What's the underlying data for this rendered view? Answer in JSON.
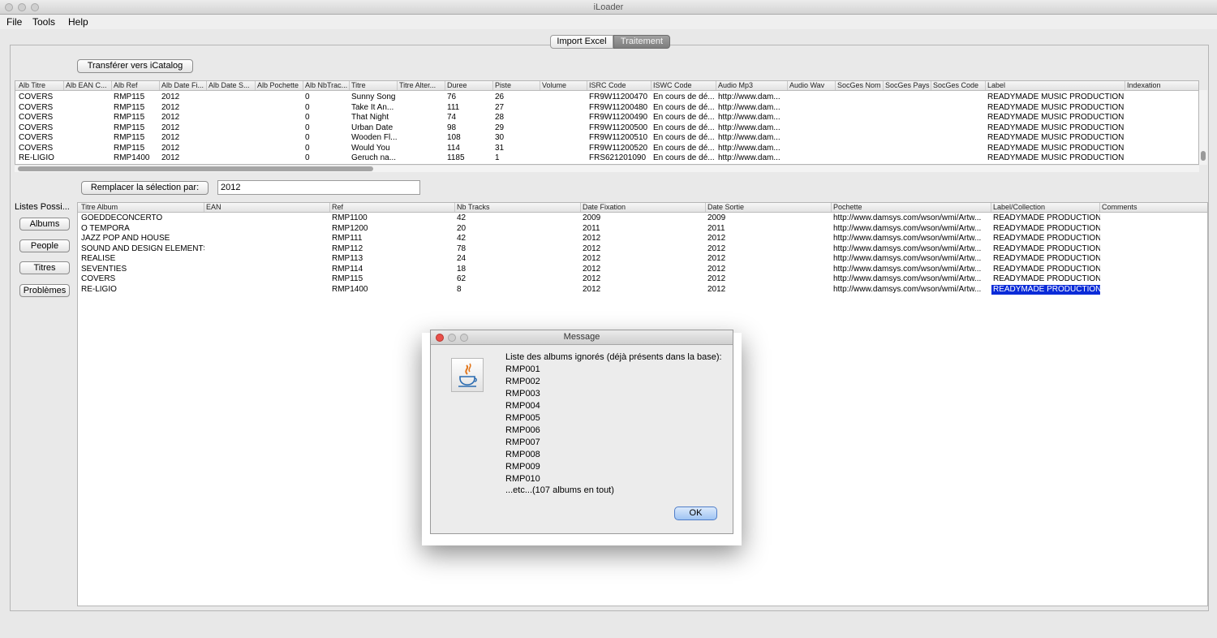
{
  "window": {
    "title": "iLoader"
  },
  "menu": {
    "items": [
      "File",
      "Tools",
      "Help"
    ]
  },
  "tabs": [
    {
      "label": "Import Excel",
      "active": false
    },
    {
      "label": "Traitement",
      "active": true
    }
  ],
  "toolbar": {
    "transfer_label": "Transférer vers iCatalog",
    "replace_label": "Remplacer la sélection par:",
    "replace_value": "2012"
  },
  "top_table": {
    "columns": [
      "Alb Titre",
      "Alb EAN C...",
      "Alb Ref",
      "Alb Date Fi...",
      "Alb Date S...",
      "Alb Pochette",
      "Alb NbTrac...",
      "Titre",
      "Titre Alter...",
      "Duree",
      "Piste",
      "Volume",
      "ISRC Code",
      "ISWC Code",
      "Audio Mp3",
      "Audio Wav",
      "SocGes Nom",
      "SocGes Pays",
      "SocGes Code",
      "Label",
      "Indexation"
    ],
    "rows": [
      [
        "COVERS",
        "",
        "RMP115",
        "2012",
        "",
        "",
        "0",
        "Sunny Song",
        "",
        "76",
        "26",
        "",
        "FR9W11200470",
        "En cours de dé...",
        "http://www.dam...",
        "",
        "",
        "",
        "",
        "READYMADE MUSIC PRODUCTION",
        ""
      ],
      [
        "COVERS",
        "",
        "RMP115",
        "2012",
        "",
        "",
        "0",
        "Take It An...",
        "",
        "111",
        "27",
        "",
        "FR9W11200480",
        "En cours de dé...",
        "http://www.dam...",
        "",
        "",
        "",
        "",
        "READYMADE MUSIC PRODUCTION",
        ""
      ],
      [
        "COVERS",
        "",
        "RMP115",
        "2012",
        "",
        "",
        "0",
        "That Night",
        "",
        "74",
        "28",
        "",
        "FR9W11200490",
        "En cours de dé...",
        "http://www.dam...",
        "",
        "",
        "",
        "",
        "READYMADE MUSIC PRODUCTION",
        ""
      ],
      [
        "COVERS",
        "",
        "RMP115",
        "2012",
        "",
        "",
        "0",
        "Urban Date",
        "",
        "98",
        "29",
        "",
        "FR9W11200500",
        "En cours de dé...",
        "http://www.dam...",
        "",
        "",
        "",
        "",
        "READYMADE MUSIC PRODUCTION",
        ""
      ],
      [
        "COVERS",
        "",
        "RMP115",
        "2012",
        "",
        "",
        "0",
        "Wooden Fl...",
        "",
        "108",
        "30",
        "",
        "FR9W11200510",
        "En cours de dé...",
        "http://www.dam...",
        "",
        "",
        "",
        "",
        "READYMADE MUSIC PRODUCTION",
        ""
      ],
      [
        "COVERS",
        "",
        "RMP115",
        "2012",
        "",
        "",
        "0",
        "Would You",
        "",
        "114",
        "31",
        "",
        "FR9W11200520",
        "En cours de dé...",
        "http://www.dam...",
        "",
        "",
        "",
        "",
        "READYMADE MUSIC PRODUCTION",
        ""
      ],
      [
        "RE-LIGIO",
        "",
        "RMP1400",
        "2012",
        "",
        "",
        "0",
        "Geruch na...",
        "",
        "1185",
        "1",
        "",
        "FRS621201090",
        "En cours de dé...",
        "http://www.dam...",
        "",
        "",
        "",
        "",
        "READYMADE MUSIC PRODUCTION",
        ""
      ]
    ]
  },
  "side": {
    "label": "Listes Possi...",
    "buttons": [
      "Albums",
      "People",
      "Titres",
      "Problèmes"
    ]
  },
  "bottom_table": {
    "columns": [
      "Titre Album",
      "EAN",
      "Ref",
      "Nb Tracks",
      "Date Fixation",
      "Date Sortie",
      "Pochette",
      "Label/Collection",
      "Comments"
    ],
    "rows": [
      [
        "GOEDDECONCERTO",
        "",
        "RMP1100",
        "42",
        "2009",
        "2009",
        "http://www.damsys.com/wson/wmi/Artw...",
        "READYMADE PRODUCTION",
        ""
      ],
      [
        "O TEMPORA",
        "",
        "RMP1200",
        "20",
        "2011",
        "2011",
        "http://www.damsys.com/wson/wmi/Artw...",
        "READYMADE PRODUCTION",
        ""
      ],
      [
        "JAZZ POP AND HOUSE",
        "",
        "RMP111",
        "42",
        "2012",
        "2012",
        "http://www.damsys.com/wson/wmi/Artw...",
        "READYMADE PRODUCTION",
        ""
      ],
      [
        "SOUND AND DESIGN ELEMENTS...",
        "",
        "RMP112",
        "78",
        "2012",
        "2012",
        "http://www.damsys.com/wson/wmi/Artw...",
        "READYMADE PRODUCTION",
        ""
      ],
      [
        "REALISE",
        "",
        "RMP113",
        "24",
        "2012",
        "2012",
        "http://www.damsys.com/wson/wmi/Artw...",
        "READYMADE PRODUCTION",
        ""
      ],
      [
        "SEVENTIES",
        "",
        "RMP114",
        "18",
        "2012",
        "2012",
        "http://www.damsys.com/wson/wmi/Artw...",
        "READYMADE PRODUCTION",
        ""
      ],
      [
        "COVERS",
        "",
        "RMP115",
        "62",
        "2012",
        "2012",
        "http://www.damsys.com/wson/wmi/Artw...",
        "READYMADE PRODUCTION",
        ""
      ],
      [
        "RE-LIGIO",
        "",
        "RMP1400",
        "8",
        "2012",
        "2012",
        "http://www.damsys.com/wson/wmi/Artw...",
        "READYMADE PRODUCTION",
        ""
      ]
    ]
  },
  "dialog": {
    "title": "Message",
    "heading": "Liste des albums ignorés (déjà présents dans la base):",
    "items": [
      "RMP001",
      "RMP002",
      "RMP003",
      "RMP004",
      "RMP005",
      "RMP006",
      "RMP007",
      "RMP008",
      "RMP009",
      "RMP010"
    ],
    "footer": "...etc...(107 albums en tout)",
    "ok_label": "OK"
  },
  "colors": {
    "selection": "#0a2bd8",
    "ok_button": "#bcd7f7"
  }
}
